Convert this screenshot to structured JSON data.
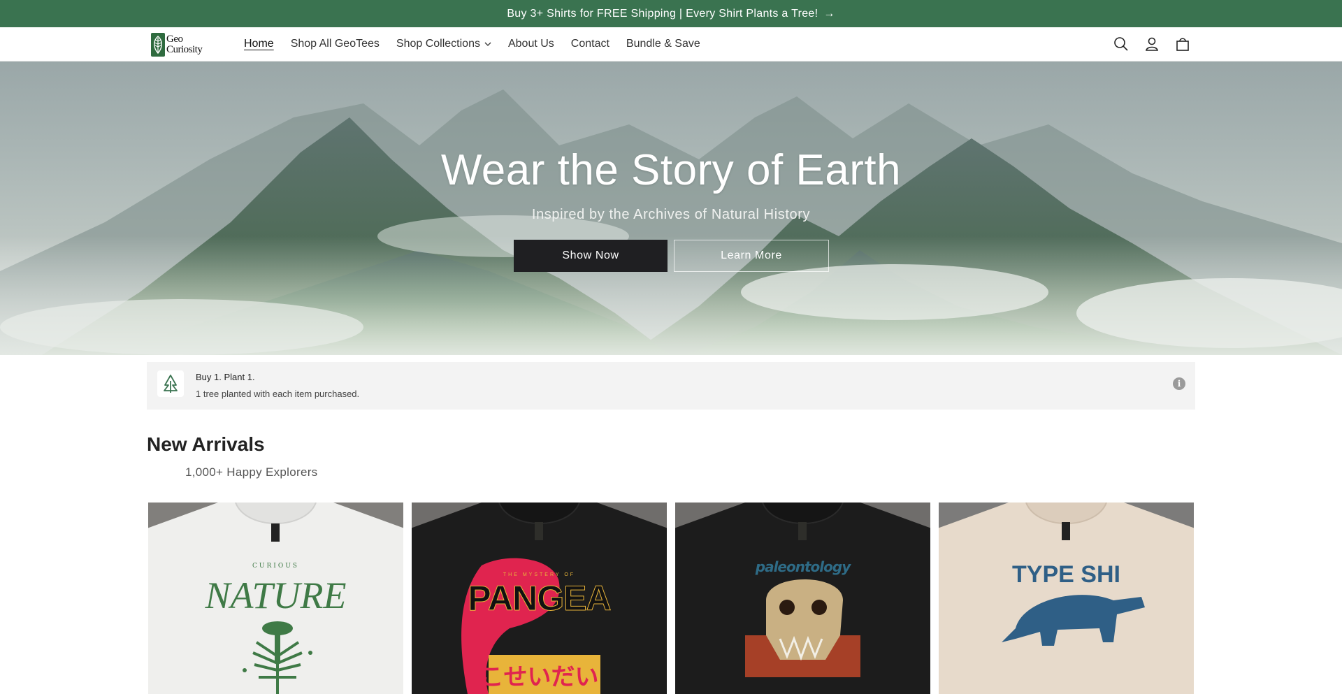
{
  "announcement": {
    "text": "Buy 3+ Shirts for FREE Shipping | Every Shirt Plants a Tree!",
    "arrow": "→"
  },
  "header": {
    "logo": {
      "line1": "Geo",
      "line2": "Curiosity"
    },
    "nav": [
      {
        "label": "Home",
        "active": true
      },
      {
        "label": "Shop All GeoTees"
      },
      {
        "label": "Shop Collections",
        "has_dropdown": true
      },
      {
        "label": "About Us"
      },
      {
        "label": "Contact"
      },
      {
        "label": "Bundle & Save"
      }
    ],
    "icons": [
      "search-icon",
      "account-icon",
      "cart-icon"
    ]
  },
  "hero": {
    "title": "Wear the Story of Earth",
    "subtitle": "Inspired by the Archives of Natural History",
    "primary_button": "Show Now",
    "secondary_button": "Learn More"
  },
  "promo": {
    "title": "Buy 1. Plant 1.",
    "description": "1 tree planted with each item purchased.",
    "info_glyph": "i"
  },
  "new_arrivals": {
    "title": "New Arrivals",
    "subtitle": "1,000+ Happy Explorers",
    "products": [
      {
        "shirt_color": "#efefed",
        "design_text_top": "CURIOUS",
        "design_text_main": "NATURE",
        "design_color": "#3f7a46"
      },
      {
        "shirt_color": "#1c1c1c",
        "design_text_top": "THE MYSTERY OF",
        "design_text_main": "PANGEA",
        "design_text_sub": "こせいだい",
        "design_color": "#e0244f"
      },
      {
        "shirt_color": "#1c1c1c",
        "design_text_main": "paleontology",
        "design_color": "#c94a2a"
      },
      {
        "shirt_color": "#e7dacb",
        "design_text_main": "TYPE SHI",
        "design_color": "#2f5f86"
      }
    ]
  },
  "colors": {
    "announcement_bg": "#3a7350",
    "button_dark": "#1f1f22",
    "promo_bg": "#f3f3f3"
  }
}
